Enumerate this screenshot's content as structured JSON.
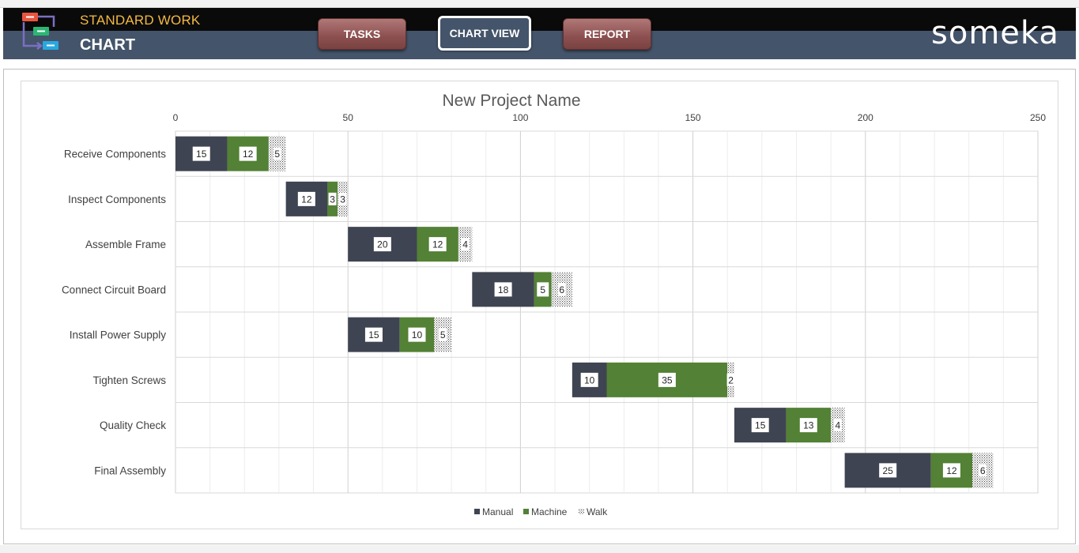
{
  "header": {
    "title_line1": "STANDARD WORK",
    "title_line2": "CHART",
    "logo_icon": "flowchart-icon",
    "brand": "someka"
  },
  "nav": {
    "tasks": "TASKS",
    "chart_view": "CHART VIEW",
    "report": "REPORT"
  },
  "colors": {
    "manual": "#3f4452",
    "machine": "#538135",
    "walk_pattern": "dotted",
    "header_dark": "#0a0a0a",
    "header_slate": "#44546a",
    "title_accent": "#f4b942"
  },
  "chart_data": {
    "type": "bar",
    "orientation": "horizontal-stacked-gantt",
    "title": "New Project Name",
    "xlim": [
      0,
      250
    ],
    "x_ticks": [
      0,
      50,
      100,
      150,
      200,
      250
    ],
    "x_axis_position": "top",
    "grid": true,
    "legend_position": "bottom",
    "categories": [
      "Receive Components",
      "Inspect Components",
      "Assemble Frame",
      "Connect Circuit Board",
      "Install Power Supply",
      "Tighten Screws",
      "Quality Check",
      "Final Assembly"
    ],
    "start": [
      0,
      32,
      50,
      86,
      50,
      115,
      162,
      194
    ],
    "series": [
      {
        "name": "Manual",
        "values": [
          15,
          12,
          20,
          18,
          15,
          10,
          15,
          25
        ]
      },
      {
        "name": "Machine",
        "values": [
          12,
          3,
          12,
          5,
          10,
          35,
          13,
          12
        ]
      },
      {
        "name": "Walk",
        "values": [
          5,
          3,
          4,
          6,
          5,
          2,
          4,
          6
        ]
      }
    ]
  }
}
